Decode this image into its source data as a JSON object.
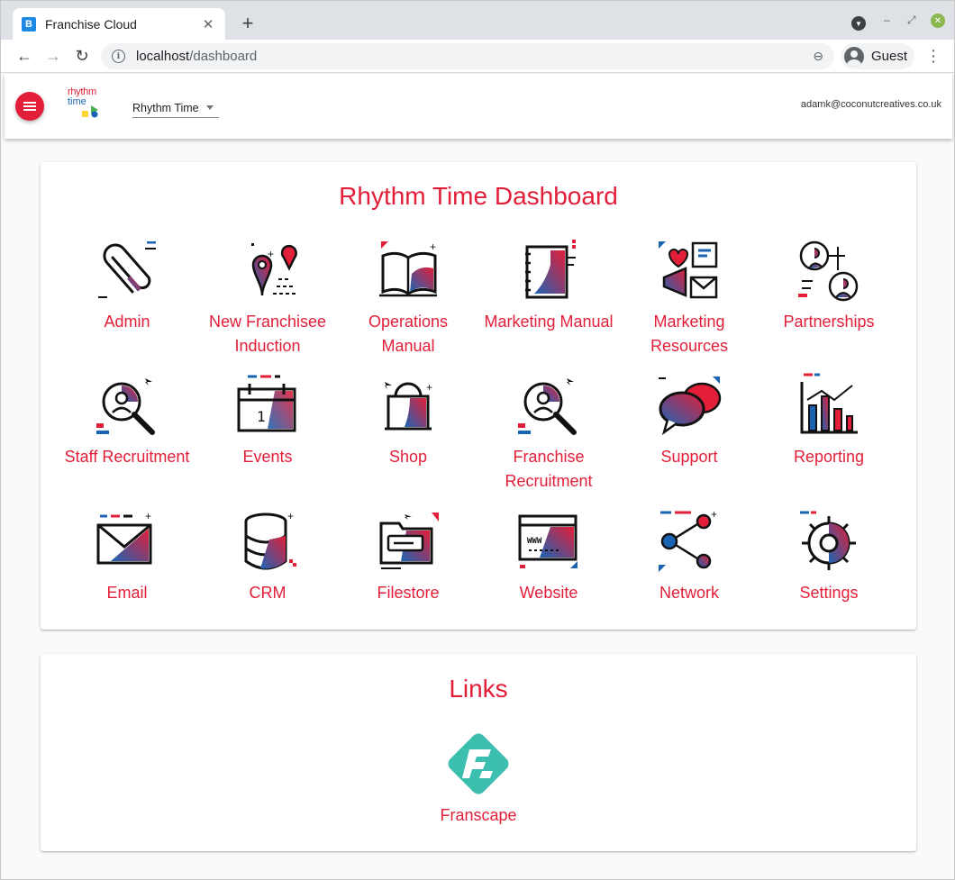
{
  "browser": {
    "tab_title": "Franchise Cloud",
    "favicon_letter": "B",
    "url_host": "localhost",
    "url_path": "/dashboard",
    "profile_name": "Guest"
  },
  "header": {
    "brand_line1": "rhythm",
    "brand_line2": "time",
    "org_selected": "Rhythm Time",
    "user_email": "adamk@coconutcreatives.co.uk"
  },
  "dashboard": {
    "title": "Rhythm Time Dashboard",
    "tiles": [
      {
        "label": "Admin",
        "icon": "paperclip-icon"
      },
      {
        "label": "New Franchisee Induction",
        "icon": "map-pin-route-icon"
      },
      {
        "label": "Operations Manual",
        "icon": "open-book-icon"
      },
      {
        "label": "Marketing Manual",
        "icon": "notebook-icon"
      },
      {
        "label": "Marketing Resources",
        "icon": "megaphone-icon"
      },
      {
        "label": "Partnerships",
        "icon": "people-network-icon"
      },
      {
        "label": "Staff Recruitment",
        "icon": "magnifier-person-icon"
      },
      {
        "label": "Events",
        "icon": "calendar-icon"
      },
      {
        "label": "Shop",
        "icon": "shopping-bag-icon"
      },
      {
        "label": "Franchise Recruitment",
        "icon": "magnifier-person-icon"
      },
      {
        "label": "Support",
        "icon": "chat-bubbles-icon"
      },
      {
        "label": "Reporting",
        "icon": "bar-chart-icon"
      },
      {
        "label": "Email",
        "icon": "envelope-icon"
      },
      {
        "label": "CRM",
        "icon": "database-icon"
      },
      {
        "label": "Filestore",
        "icon": "folder-icon"
      },
      {
        "label": "Website",
        "icon": "web-window-icon"
      },
      {
        "label": "Network",
        "icon": "share-network-icon"
      },
      {
        "label": "Settings",
        "icon": "gear-icon"
      }
    ]
  },
  "links": {
    "title": "Links",
    "items": [
      {
        "label": "Franscape",
        "icon": "franscape-logo-icon"
      }
    ]
  },
  "colors": {
    "brand_red": "#e31e38",
    "brand_blue": "#1b64b4",
    "franscape_teal": "#3cbfae"
  }
}
